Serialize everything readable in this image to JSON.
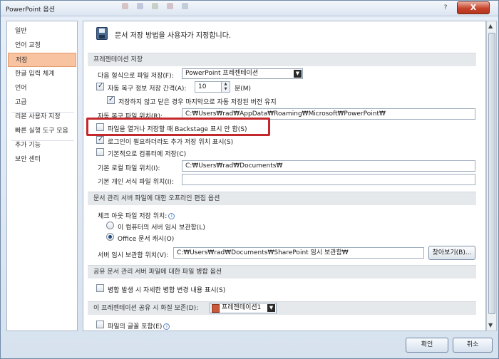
{
  "window": {
    "title": "PowerPoint 옵션",
    "help_glyph": "?",
    "close_glyph": "X"
  },
  "nav": {
    "items": [
      "일반",
      "언어 교정",
      "저장",
      "한글 입력 체계",
      "언어",
      "고급",
      "리본 사용자 지정",
      "빠른 실행 도구 모음",
      "추가 기능",
      "보안 센터"
    ],
    "active_index": 2
  },
  "header": {
    "title": "문서 저장 방법을 사용자가 지정합니다."
  },
  "save_presentation": {
    "section_title": "프레젠테이션 저장",
    "format_label": "다음 형식으로 파일 저장(F):",
    "format_value": "PowerPoint 프레젠테이션",
    "autorecover_label": "자동 복구 정보 저장 간격(A):",
    "autorecover_checked": true,
    "autorecover_value": "10",
    "minutes_label": "분(M)",
    "keep_last_label": "저장하지 않고 닫은 경우 마지막으로 자동 저장된 버전 유지",
    "keep_last_checked": true,
    "autorecover_location_label": "자동 복구 파일 위치(R):",
    "autorecover_location_value": "C:₩Users₩rad₩AppData₩Roaming₩Microsoft₩PowerPoint₩",
    "no_backstage_label": "파일을 열거나 저장할 때 Backstage 표시 안 함(S)",
    "no_backstage_checked": false,
    "show_extra_label": "로그인이 필요하더라도 추가 저장 위치 표시(S)",
    "show_extra_checked": true,
    "save_local_label": "기본적으로 컴퓨터에 저장(C)",
    "save_local_checked": false,
    "default_local_label": "기본 로컬 파일 위치(I):",
    "default_local_value": "C:₩Users₩rad₩Documents₩",
    "personal_templates_label": "기본 개인 서식 파일 위치(I):",
    "personal_templates_value": ""
  },
  "offline_editing": {
    "section_title": "문서 관리 서버 파일에 대한 오프라인 편집 옵션",
    "checked_out_label": "체크 아웃 파일 저장 위치:",
    "option_server_drafts": "이 컴퓨터의 서버 임시 보관함(L)",
    "option_office_cache": "Office 문서 캐시(O)",
    "selected": "office_cache",
    "server_drafts_label": "서버 임시 보관함 위치(V):",
    "server_drafts_value": "C:₩Users₩rad₩Documents₩SharePoint 임시 보관함₩",
    "browse_label": "찾아보기(B)..."
  },
  "merge": {
    "section_title": "공유 문서 관리 서버 파일에 대한 파일 병합 옵션",
    "show_detail_label": "병합 발생 시 자세한 병합 변경 내용 표시(S)",
    "show_detail_checked": false
  },
  "fidelity": {
    "section_title": "이 프레젠테이션 공유 시 화질 보존(D):",
    "presentation_value": "프레젠테이션1",
    "embed_fonts_label": "파일의 글꼴 포함(E)",
    "embed_fonts_checked": false
  },
  "footer": {
    "ok_label": "확인",
    "cancel_label": "취소"
  },
  "colors": {
    "highlight": "#c3282c",
    "nav_active": "#f7c3a1",
    "section_bg": "#e6e9ec"
  }
}
